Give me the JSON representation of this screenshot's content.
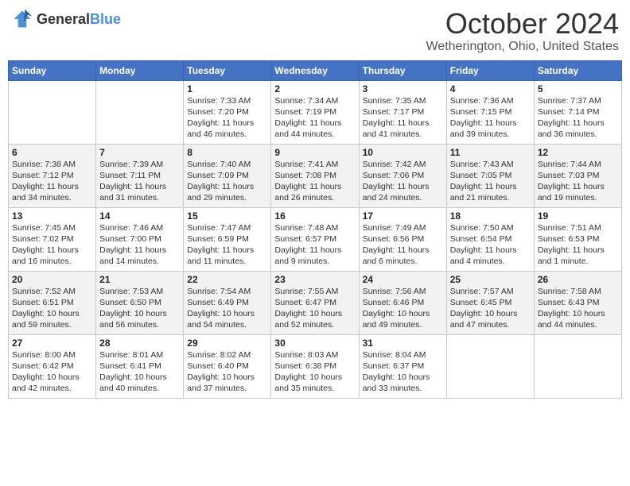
{
  "header": {
    "logo": {
      "general": "General",
      "blue": "Blue"
    },
    "title": "October 2024",
    "location": "Wetherington, Ohio, United States"
  },
  "weekdays": [
    "Sunday",
    "Monday",
    "Tuesday",
    "Wednesday",
    "Thursday",
    "Friday",
    "Saturday"
  ],
  "weeks": [
    [
      null,
      null,
      {
        "day": "1",
        "sunrise": "7:33 AM",
        "sunset": "7:20 PM",
        "daylight": "11 hours and 46 minutes."
      },
      {
        "day": "2",
        "sunrise": "7:34 AM",
        "sunset": "7:19 PM",
        "daylight": "11 hours and 44 minutes."
      },
      {
        "day": "3",
        "sunrise": "7:35 AM",
        "sunset": "7:17 PM",
        "daylight": "11 hours and 41 minutes."
      },
      {
        "day": "4",
        "sunrise": "7:36 AM",
        "sunset": "7:15 PM",
        "daylight": "11 hours and 39 minutes."
      },
      {
        "day": "5",
        "sunrise": "7:37 AM",
        "sunset": "7:14 PM",
        "daylight": "11 hours and 36 minutes."
      }
    ],
    [
      {
        "day": "6",
        "sunrise": "7:38 AM",
        "sunset": "7:12 PM",
        "daylight": "11 hours and 34 minutes."
      },
      {
        "day": "7",
        "sunrise": "7:39 AM",
        "sunset": "7:11 PM",
        "daylight": "11 hours and 31 minutes."
      },
      {
        "day": "8",
        "sunrise": "7:40 AM",
        "sunset": "7:09 PM",
        "daylight": "11 hours and 29 minutes."
      },
      {
        "day": "9",
        "sunrise": "7:41 AM",
        "sunset": "7:08 PM",
        "daylight": "11 hours and 26 minutes."
      },
      {
        "day": "10",
        "sunrise": "7:42 AM",
        "sunset": "7:06 PM",
        "daylight": "11 hours and 24 minutes."
      },
      {
        "day": "11",
        "sunrise": "7:43 AM",
        "sunset": "7:05 PM",
        "daylight": "11 hours and 21 minutes."
      },
      {
        "day": "12",
        "sunrise": "7:44 AM",
        "sunset": "7:03 PM",
        "daylight": "11 hours and 19 minutes."
      }
    ],
    [
      {
        "day": "13",
        "sunrise": "7:45 AM",
        "sunset": "7:02 PM",
        "daylight": "11 hours and 16 minutes."
      },
      {
        "day": "14",
        "sunrise": "7:46 AM",
        "sunset": "7:00 PM",
        "daylight": "11 hours and 14 minutes."
      },
      {
        "day": "15",
        "sunrise": "7:47 AM",
        "sunset": "6:59 PM",
        "daylight": "11 hours and 11 minutes."
      },
      {
        "day": "16",
        "sunrise": "7:48 AM",
        "sunset": "6:57 PM",
        "daylight": "11 hours and 9 minutes."
      },
      {
        "day": "17",
        "sunrise": "7:49 AM",
        "sunset": "6:56 PM",
        "daylight": "11 hours and 6 minutes."
      },
      {
        "day": "18",
        "sunrise": "7:50 AM",
        "sunset": "6:54 PM",
        "daylight": "11 hours and 4 minutes."
      },
      {
        "day": "19",
        "sunrise": "7:51 AM",
        "sunset": "6:53 PM",
        "daylight": "11 hours and 1 minute."
      }
    ],
    [
      {
        "day": "20",
        "sunrise": "7:52 AM",
        "sunset": "6:51 PM",
        "daylight": "10 hours and 59 minutes."
      },
      {
        "day": "21",
        "sunrise": "7:53 AM",
        "sunset": "6:50 PM",
        "daylight": "10 hours and 56 minutes."
      },
      {
        "day": "22",
        "sunrise": "7:54 AM",
        "sunset": "6:49 PM",
        "daylight": "10 hours and 54 minutes."
      },
      {
        "day": "23",
        "sunrise": "7:55 AM",
        "sunset": "6:47 PM",
        "daylight": "10 hours and 52 minutes."
      },
      {
        "day": "24",
        "sunrise": "7:56 AM",
        "sunset": "6:46 PM",
        "daylight": "10 hours and 49 minutes."
      },
      {
        "day": "25",
        "sunrise": "7:57 AM",
        "sunset": "6:45 PM",
        "daylight": "10 hours and 47 minutes."
      },
      {
        "day": "26",
        "sunrise": "7:58 AM",
        "sunset": "6:43 PM",
        "daylight": "10 hours and 44 minutes."
      }
    ],
    [
      {
        "day": "27",
        "sunrise": "8:00 AM",
        "sunset": "6:42 PM",
        "daylight": "10 hours and 42 minutes."
      },
      {
        "day": "28",
        "sunrise": "8:01 AM",
        "sunset": "6:41 PM",
        "daylight": "10 hours and 40 minutes."
      },
      {
        "day": "29",
        "sunrise": "8:02 AM",
        "sunset": "6:40 PM",
        "daylight": "10 hours and 37 minutes."
      },
      {
        "day": "30",
        "sunrise": "8:03 AM",
        "sunset": "6:38 PM",
        "daylight": "10 hours and 35 minutes."
      },
      {
        "day": "31",
        "sunrise": "8:04 AM",
        "sunset": "6:37 PM",
        "daylight": "10 hours and 33 minutes."
      },
      null,
      null
    ]
  ],
  "labels": {
    "sunrise": "Sunrise:",
    "sunset": "Sunset:",
    "daylight": "Daylight:"
  }
}
